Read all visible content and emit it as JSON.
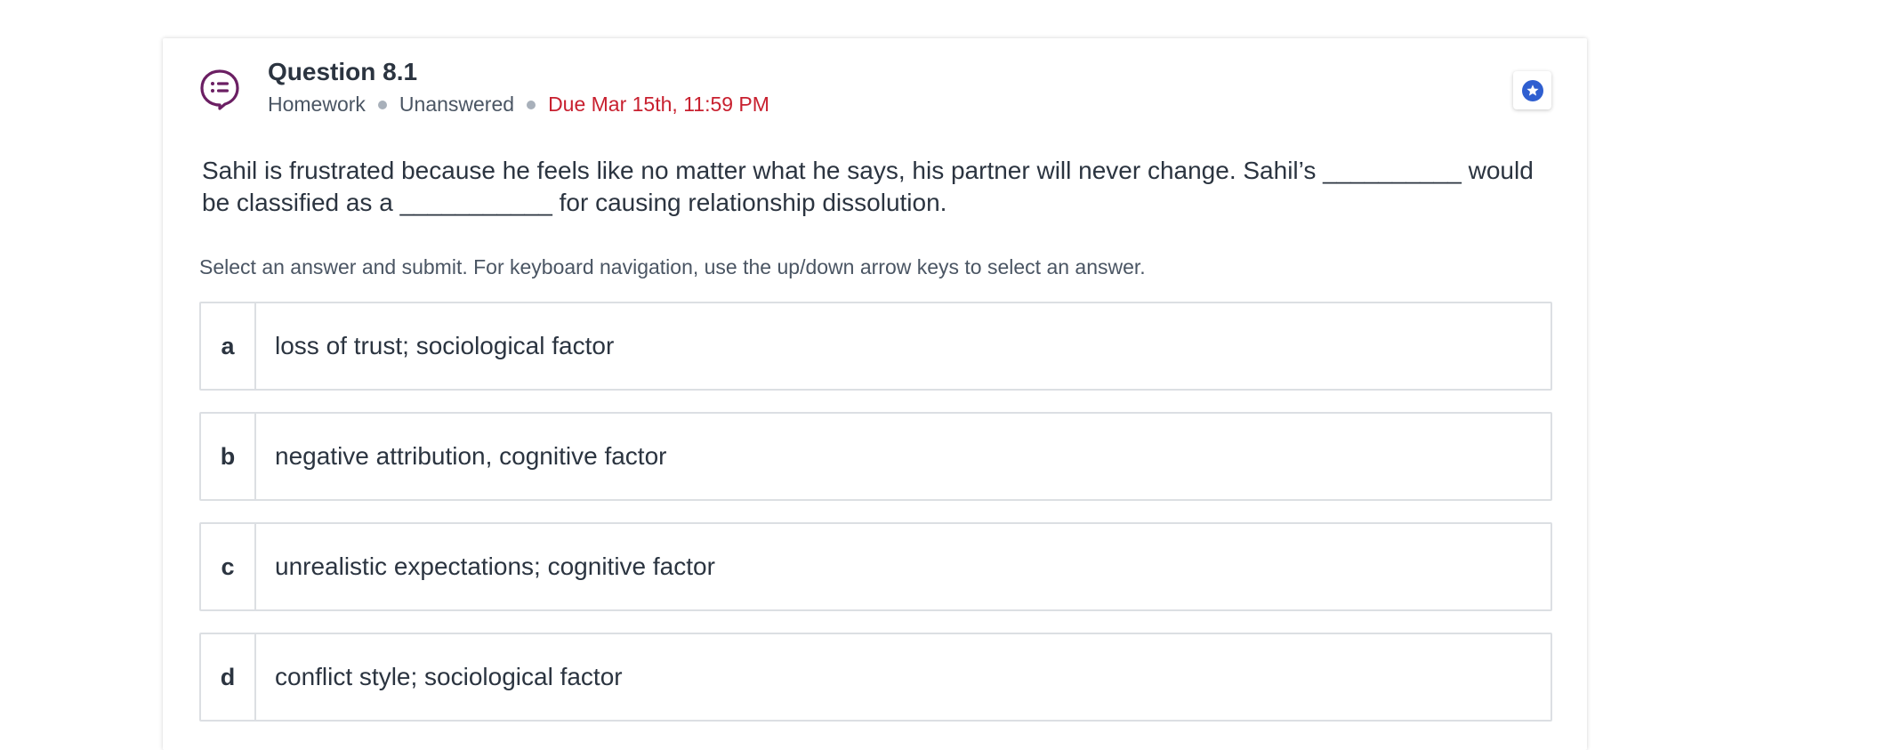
{
  "question": {
    "title": "Question 8.1",
    "type": "Homework",
    "status": "Unanswered",
    "due": "Due Mar 15th, 11:59 PM",
    "prompt": "Sahil is frustrated because he feels like no matter what he says, his partner will never change. Sahil’s __________ would be classified as a ___________ for causing relationship dissolution.",
    "instructions": "Select an answer and submit. For keyboard navigation, use the up/down arrow keys to select an answer."
  },
  "options": [
    {
      "letter": "a",
      "text": "loss of trust; sociological factor"
    },
    {
      "letter": "b",
      "text": "negative attribution, cognitive factor"
    },
    {
      "letter": "c",
      "text": "unrealistic expectations; cognitive factor"
    },
    {
      "letter": "d",
      "text": "conflict style; sociological factor"
    }
  ],
  "icons": {
    "question_icon": "chat-list-icon",
    "bookmark_icon": "star-badge-icon"
  },
  "colors": {
    "question_icon": "#6b1f63",
    "due_text": "#c8202f",
    "star_badge": "#2f5fd0",
    "border": "#dcdfe3"
  }
}
